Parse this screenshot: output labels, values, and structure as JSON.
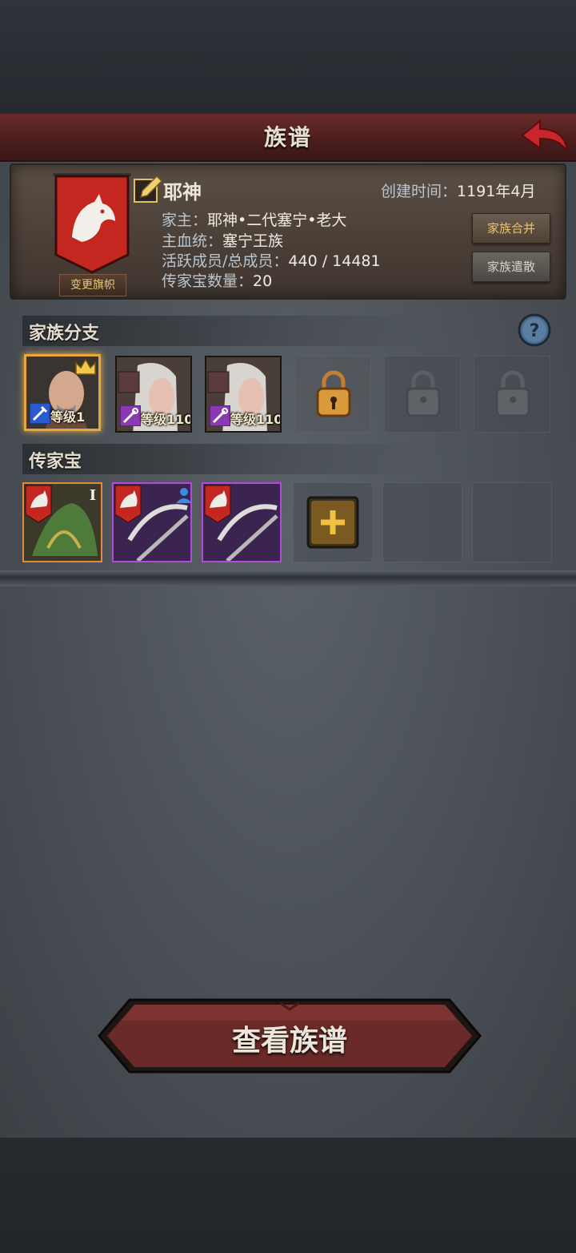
{
  "header": {
    "title": "族谱"
  },
  "family": {
    "name": "耶神",
    "created_label": "创建时间：",
    "created_value": "1191年4月",
    "banner_button": "变更旗帜",
    "head_label": "家主：",
    "head_value": "耶神•二代塞宁•老大",
    "bloodline_label": "主血统：",
    "bloodline_value": "塞宁王族",
    "members_label": "活跃成员/总成员：",
    "members_value": "440 / 14481",
    "heirloom_count_label": "传家宝数量：",
    "heirloom_count_value": "20",
    "merge_button": "家族合并",
    "disband_button": "家族遣散"
  },
  "branches": {
    "title": "家族分支",
    "heroes": [
      {
        "level": "等级1",
        "crown": true
      },
      {
        "level": "等级110",
        "crown": false
      },
      {
        "level": "等级110",
        "crown": false
      }
    ]
  },
  "heirlooms": {
    "title": "传家宝",
    "items": [
      {
        "rarity": "orange",
        "tier": "I"
      },
      {
        "rarity": "purple"
      },
      {
        "rarity": "purple"
      }
    ]
  },
  "footer": {
    "view_button": "查看族谱"
  },
  "colors": {
    "title_red": "#4a1c1c",
    "gold": "#e9a63a",
    "purple": "#b44ad8",
    "orange": "#e08a3a"
  },
  "icons": [
    "back-arrow-icon",
    "edit-icon",
    "wolf-banner-icon",
    "crown-icon",
    "sword-icon",
    "staff-icon",
    "lock-icon",
    "help-icon",
    "plus-icon",
    "person-icon"
  ]
}
